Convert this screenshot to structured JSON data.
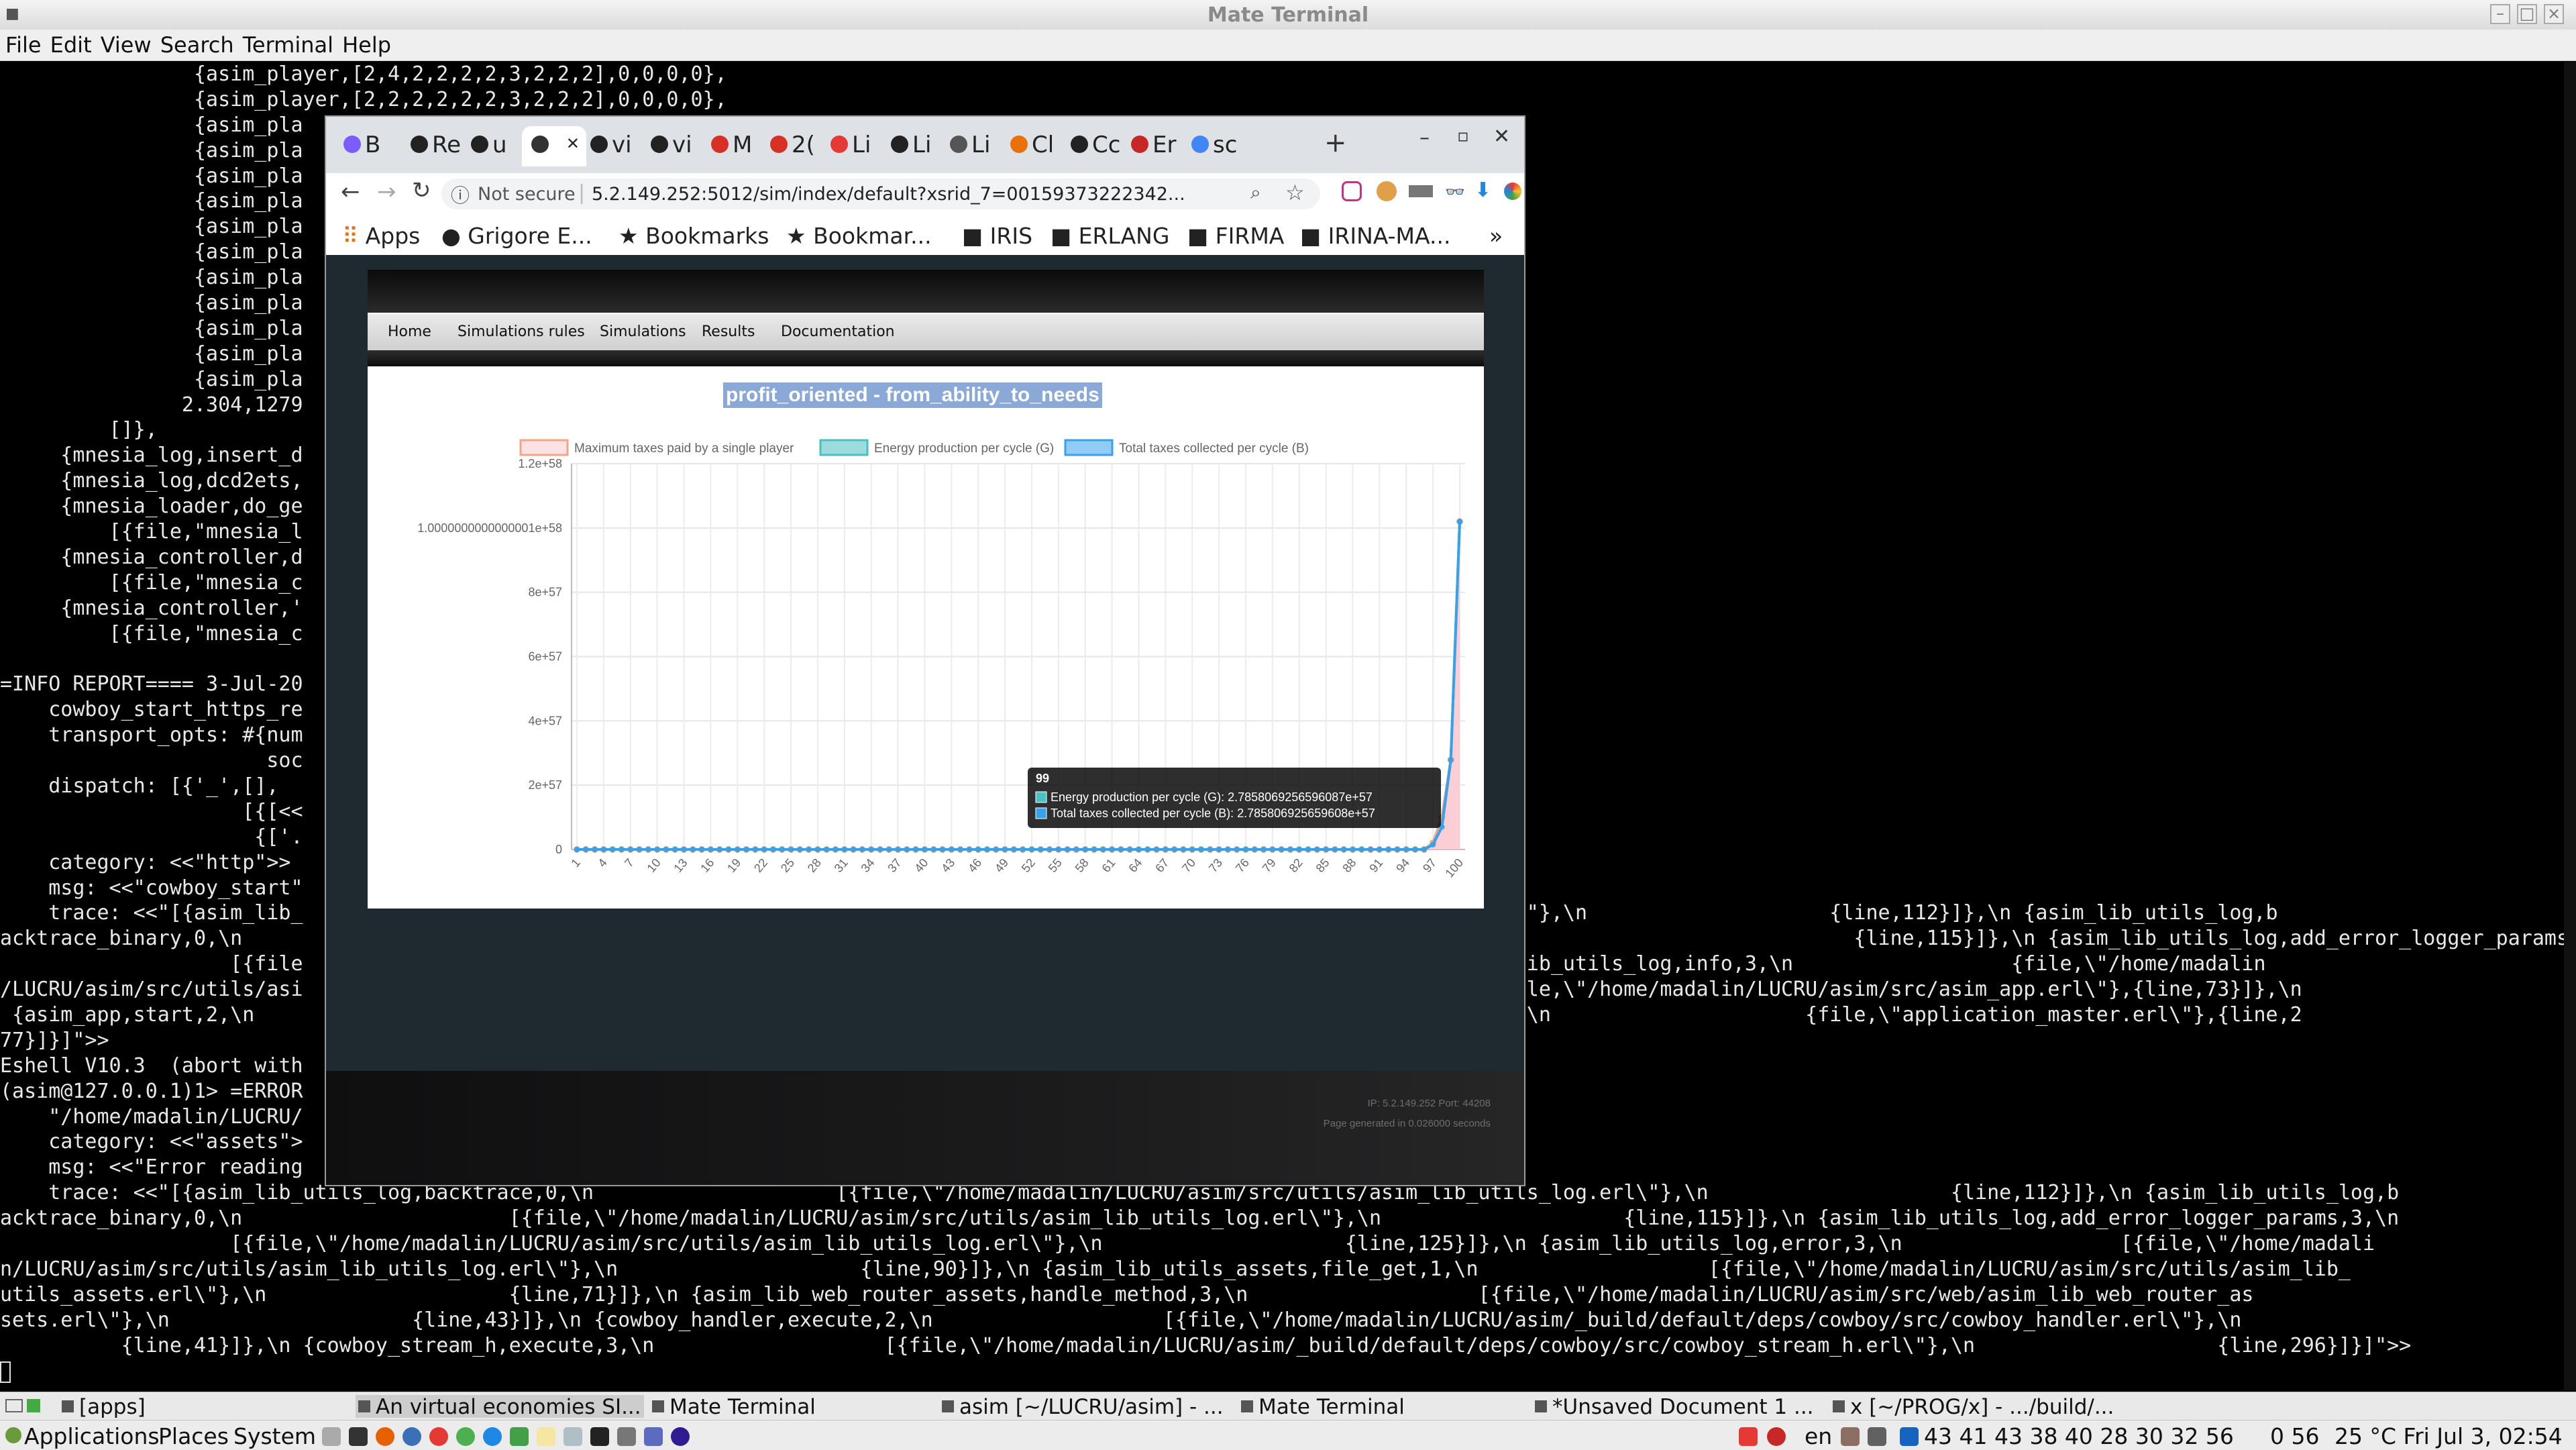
{
  "terminal": {
    "title": "Mate Terminal",
    "menu": [
      "File",
      "Edit",
      "View",
      "Search",
      "Terminal",
      "Help"
    ],
    "lines": [
      "                {asim_player,[2,4,2,2,2,2,3,2,2,2],0,0,0,0},",
      "                {asim_player,[2,2,2,2,2,2,3,2,2,2],0,0,0,0},",
      "                {asim_pla",
      "                {asim_pla",
      "                {asim_pla",
      "                {asim_pla",
      "                {asim_pla",
      "                {asim_pla",
      "                {asim_pla",
      "                {asim_pla",
      "                {asim_pla",
      "                {asim_pla",
      "                {asim_pla",
      "               2.304,1279",
      "         []},",
      "     {mnesia_log,insert_d",
      "     {mnesia_log,dcd2ets,",
      "     {mnesia_loader,do_ge",
      "         [{file,\"mnesia_l",
      "     {mnesia_controller,d",
      "         [{file,\"mnesia_c",
      "     {mnesia_controller,'",
      "         [{file,\"mnesia_c",
      "",
      "=INFO REPORT==== 3-Jul-20",
      "    cowboy_start_https_re",
      "    transport_opts: #{num",
      "                      soc",
      "    dispatch: [{'_',[],",
      "                    [{[<<",
      "                     {['.",
      "    category: <<\"http\">>",
      "    msg: <<\"cowboy_start\"",
      "    trace: <<\"[{asim_lib_                                                                                    ib_utils_log.erl\\\"},\\n                    {line,112}]},\\n {asim_lib_utils_log,b",
      "acktrace_binary,0,\\n                                                                                                                                     {line,115}]},\\n {asim_lib_utils_log,add_error_logger_params,3,\\n",
      "                   [{file                                                                                     25}]},\\n {asim_lib_utils_log,info,3,\\n                  {file,\\\"/home/madalin",
      "/LUCRU/asim/src/utils/asi                                                                                    \\n            {file,\\\"/home/madalin/LUCRU/asim/src/asim_app.erl\\\"},{line,73}]},\\n",
      " {asim_app,start,2,\\n                                                                                         ,start_it_old,4,\\n                     {file,\\\"application_master.erl\\\"},{line,2",
      "77}]}]\">>",
      "Eshell V10.3  (abort with",
      "(asim@127.0.0.1)1> =ERROR",
      "    \"/home/madalin/LUCRU/",
      "    category: <<\"assets\">",
      "    msg: <<\"Error reading",
      "    trace: <<\"[{asim_lib_utils_log,backtrace,0,\\n                    [{file,\\\"/home/madalin/LUCRU/asim/src/utils/asim_lib_utils_log.erl\\\"},\\n                    {line,112}]},\\n {asim_lib_utils_log,b",
      "acktrace_binary,0,\\n                      [{file,\\\"/home/madalin/LUCRU/asim/src/utils/asim_lib_utils_log.erl\\\"},\\n                    {line,115}]},\\n {asim_lib_utils_log,add_error_logger_params,3,\\n",
      "                   [{file,\\\"/home/madalin/LUCRU/asim/src/utils/asim_lib_utils_log.erl\\\"},\\n                    {line,125}]},\\n {asim_lib_utils_log,error,3,\\n                  [{file,\\\"/home/madali",
      "n/LUCRU/asim/src/utils/asim_lib_utils_log.erl\\\"},\\n                    {line,90}]},\\n {asim_lib_utils_assets,file_get,1,\\n                   [{file,\\\"/home/madalin/LUCRU/asim/src/utils/asim_lib_",
      "utils_assets.erl\\\"},\\n                    {line,71}]},\\n {asim_lib_web_router_assets,handle_method,3,\\n                   [{file,\\\"/home/madalin/LUCRU/asim/src/web/asim_lib_web_router_as",
      "sets.erl\\\"},\\n                    {line,43}]},\\n {cowboy_handler,execute,2,\\n                   [{file,\\\"/home/madalin/LUCRU/asim/_build/default/deps/cowboy/src/cowboy_handler.erl\\\"},\\n",
      "          {line,41}]},\\n {cowboy_stream_h,execute,3,\\n                   [{file,\\\"/home/madalin/LUCRU/asim/_build/default/deps/cowboy/src/cowboy_stream_h.erl\\\"},\\n                    {line,296}]}]\">>",
      ""
    ]
  },
  "browser": {
    "tabs": [
      {
        "label": "B",
        "color": "#7a5cff"
      },
      {
        "label": "Re",
        "color": "#222222"
      },
      {
        "label": "u",
        "color": "#222222"
      },
      {
        "label": "",
        "color": "#333333"
      },
      {
        "label": "vi",
        "color": "#222222"
      },
      {
        "label": "vi",
        "color": "#222222"
      },
      {
        "label": "M",
        "color": "#d93025"
      },
      {
        "label": "2(",
        "color": "#d93025"
      },
      {
        "label": "Li",
        "color": "#e53935"
      },
      {
        "label": "Li",
        "color": "#222222"
      },
      {
        "label": "Li",
        "color": "#555555"
      },
      {
        "label": "Cl",
        "color": "#e8710a"
      },
      {
        "label": "Cc",
        "color": "#222222"
      },
      {
        "label": "Er",
        "color": "#c62828"
      },
      {
        "label": "sc",
        "color": "#4285f4"
      }
    ],
    "new_tab": "+",
    "security_label": "Not secure",
    "url": "5.2.149.252:5012/sim/index/default?xsrid_7=00159373222342...",
    "bookmarks": [
      "Apps",
      "Grigore E...",
      "Bookmarks",
      "Bookmar...",
      "IRIS",
      "ERLANG",
      "FIRMA",
      "IRINA-MA..."
    ],
    "overflow": "»"
  },
  "site": {
    "nav": [
      "Home",
      "Simulations rules",
      "Simulations",
      "Results",
      "Documentation"
    ],
    "footer_ip": "IP: 5.2.149.252 Port: 44208",
    "footer_time": "Page generated in 0.026000 seconds"
  },
  "chart_data": {
    "type": "line",
    "title": "profit_oriented - from_ability_to_needs",
    "xlabel": "",
    "ylabel": "",
    "ylim": [
      0,
      1.2e+58
    ],
    "y_ticks": [
      "0",
      "2e+57",
      "4e+57",
      "6e+57",
      "8e+57",
      "1.0000000000000001e+58",
      "1.2e+58"
    ],
    "x_ticks": [
      "1",
      "4",
      "7",
      "10",
      "13",
      "16",
      "19",
      "22",
      "25",
      "28",
      "31",
      "34",
      "37",
      "40",
      "43",
      "46",
      "49",
      "52",
      "55",
      "58",
      "61",
      "64",
      "67",
      "70",
      "73",
      "76",
      "79",
      "82",
      "85",
      "88",
      "91",
      "94",
      "97",
      "100"
    ],
    "legend_position": "top",
    "grid": true,
    "series": [
      {
        "name": "Maximum taxes paid by a single player",
        "color": "#f4a582",
        "fill": "#f9c9cf",
        "values_tail": {
          "96": 0,
          "97": 2.1e+56,
          "98": 1e+57,
          "99": 2.7858e+57,
          "100": 1.02e+58
        }
      },
      {
        "name": "Energy production per cycle (G)",
        "color": "#4bc0c0",
        "values_tail": {
          "96": 0,
          "97": 1.5e+56,
          "98": 7e+56,
          "99": 2.7858e+57,
          "100": 1.02e+58
        }
      },
      {
        "name": "Total taxes collected per cycle (B)",
        "color": "#36a2eb",
        "values_tail": {
          "96": 0,
          "97": 1.5e+56,
          "98": 7e+56,
          "99": 2.7858e+57,
          "100": 1.02e+58
        }
      }
    ],
    "tooltip": {
      "title": "99",
      "lines": [
        "Energy production per cycle (G): 2.7858069256596087e+57",
        "Total taxes collected per cycle (B): 2.785806925659608e+57"
      ]
    }
  },
  "taskbar": [
    {
      "label": "[apps]",
      "active": false
    },
    {
      "label": "An virtual economies SI...",
      "active": true
    },
    {
      "label": "Mate Terminal",
      "active": false
    },
    {
      "label": "asim [~/LUCRU/asim] - ...",
      "active": false
    },
    {
      "label": "Mate Terminal",
      "active": false
    },
    {
      "label": "*Unsaved Document 1 ...",
      "active": false
    },
    {
      "label": "x [~/PROG/x] - .../build/...",
      "active": false
    }
  ],
  "panel": {
    "menus": [
      "Applications",
      "Places",
      "System"
    ],
    "language": "en",
    "stats": "43 41 43 38 40 28 30 32 56",
    "cpu": "0 56",
    "clock": "25 °C Fri Jul  3, 02:54"
  }
}
